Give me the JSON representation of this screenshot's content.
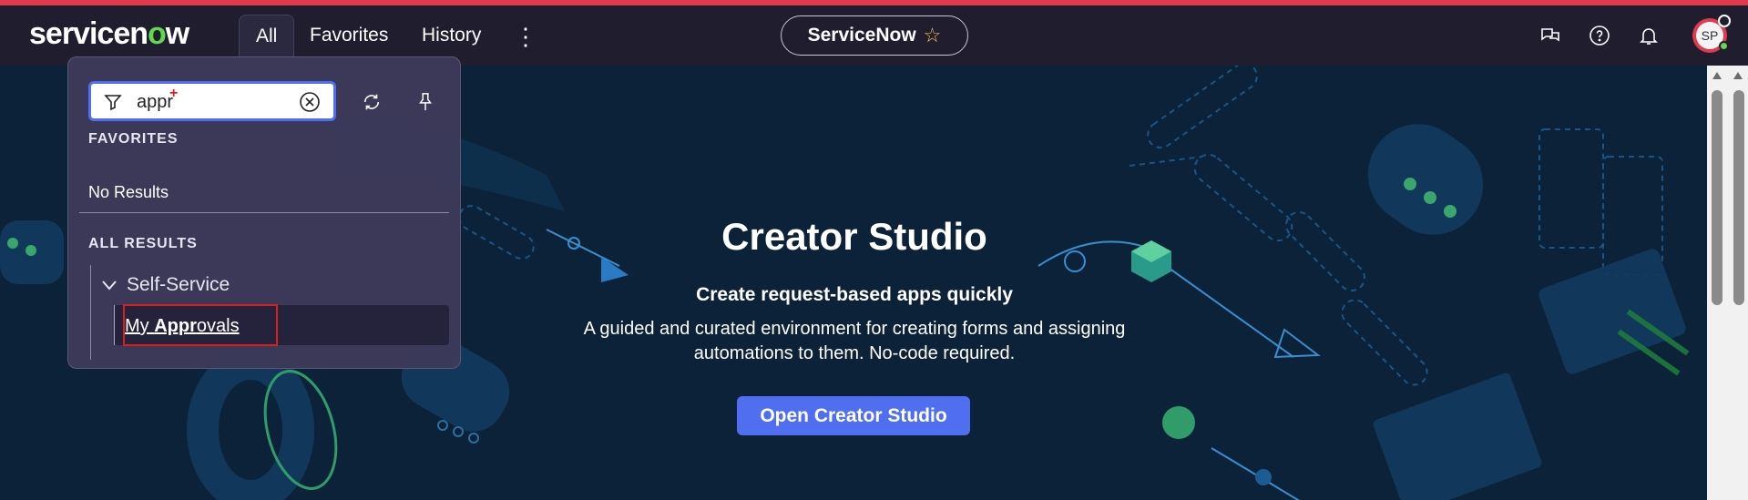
{
  "header": {
    "logo_text_a": "servicen",
    "logo_text_o": "o",
    "logo_text_b": "w",
    "tabs": [
      {
        "label": "All",
        "active": true
      },
      {
        "label": "Favorites",
        "active": false
      },
      {
        "label": "History",
        "active": false
      }
    ],
    "more_glyph": "⋮",
    "instance_label": "ServiceNow",
    "star_glyph": "☆",
    "icons": [
      "chat-icon",
      "help-icon",
      "bell-icon"
    ],
    "avatar_initials": "SP"
  },
  "menu": {
    "search_value": "appr",
    "search_cursor_mark": "+",
    "favorites_header": "FAVORITES",
    "favorites_empty": "No Results",
    "all_results_header": "ALL RESULTS",
    "group_label": "Self-Service",
    "result_prefix": "My ",
    "result_match": "Appr",
    "result_suffix": "ovals"
  },
  "hero": {
    "title": "Creator Studio",
    "subtitle": "Create request-based apps quickly",
    "description": "A guided and curated environment for creating forms and assigning automations to them. No-code required.",
    "button_label": "Open Creator Studio"
  },
  "colors": {
    "accent": "#4f6ef0",
    "brand_green": "#62d84e",
    "top_bar": "#e03a4e",
    "highlight_box": "#d92020"
  }
}
